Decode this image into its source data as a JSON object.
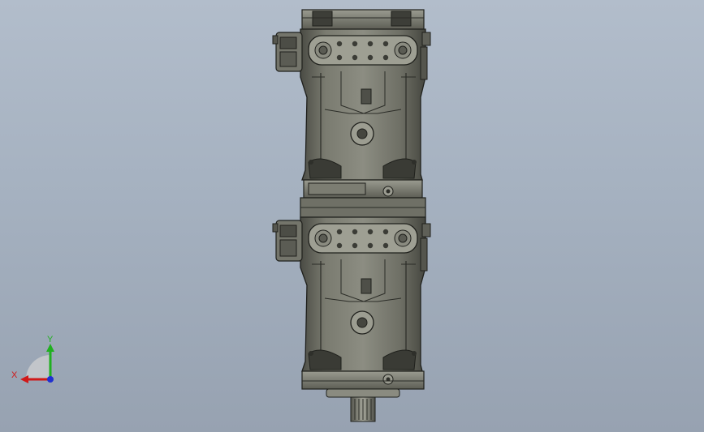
{
  "viewport": {
    "background_top": "#b2bdcb",
    "background_bottom": "#97a2b1"
  },
  "model": {
    "description_name": "tandem-hydraulic-pump-assembly",
    "body_color": "#6b6c62",
    "body_light": "#8a8b80",
    "body_dark": "#3f403a",
    "edge_color": "#1f201c"
  },
  "triad": {
    "x_label": "X",
    "y_label": "Y",
    "x_color": "#d01818",
    "y_color": "#20b020",
    "z_color": "#2030d0"
  }
}
